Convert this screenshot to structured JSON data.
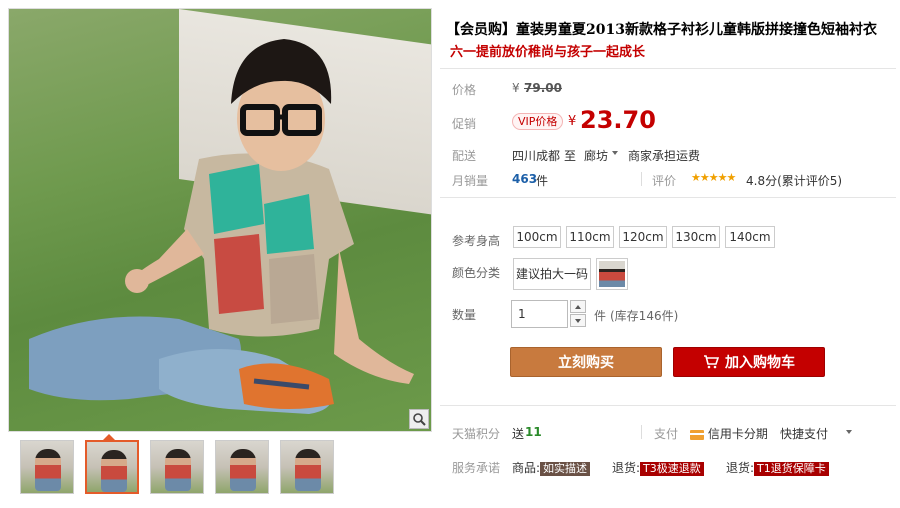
{
  "product": {
    "title": "【会员购】童装男童夏2013新款格子衬衫儿童韩版拼接撞色短袖衬衣",
    "subtitle": "六一提前放价稚尚与孩子一起成长"
  },
  "pricing": {
    "price_label": "价格",
    "currency_symbol": "¥",
    "original_price": "79.00",
    "promo_label": "促销",
    "vip_badge": "VIP价格",
    "promo_price": "23.70"
  },
  "shipping": {
    "label": "配送",
    "from": "四川成都",
    "to_word": "至",
    "destination": "廊坊",
    "fee_note": "商家承担运费"
  },
  "sales": {
    "label": "月销量",
    "count": "463",
    "unit": "件",
    "review_label": "评价",
    "stars": "★★★★★",
    "rating_text": "4.8分(累计评价5)"
  },
  "options": {
    "size_label": "参考身高",
    "sizes": [
      "100cm",
      "110cm",
      "120cm",
      "130cm",
      "140cm"
    ],
    "color_label": "颜色分类",
    "color_text_option": "建议拍大一码"
  },
  "quantity": {
    "label": "数量",
    "value": "1",
    "unit": "件",
    "stock_note": "(库存146件)"
  },
  "actions": {
    "buy_now": "立刻购买",
    "add_to_cart": "加入购物车"
  },
  "points": {
    "label": "天猫积分",
    "send_word": "送",
    "points_value": "11",
    "pay_label": "支付",
    "credit_card": "信用卡分期",
    "quick_pay": "快捷支付"
  },
  "service": {
    "label": "服务承诺",
    "goods_word": "商品:",
    "goods_tag": "如实描述",
    "return_word": "退货:",
    "return_tag": "T3极速退款",
    "refund_word": "退货:",
    "refund_tag": "T1退货保障卡"
  },
  "colors": {
    "accent_red": "#c40000",
    "buy_brown": "#c87a3e",
    "link_blue": "#1c5fa8"
  }
}
